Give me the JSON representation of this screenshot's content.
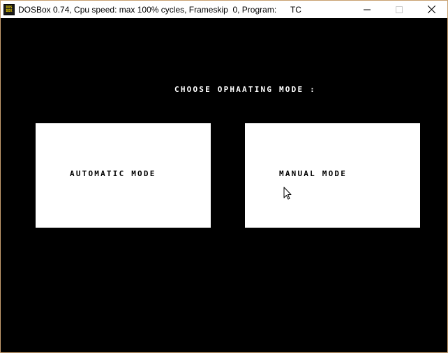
{
  "window": {
    "title": "DOSBox 0.74, Cpu speed: max 100% cycles, Frameskip  0, Program:      TC",
    "icon_text": [
      "DOS",
      "BOX"
    ],
    "controls": [
      "minimize-icon",
      "maximize-icon",
      "close-icon"
    ]
  },
  "screen": {
    "heading": "CHOOSE OPHAATING MODE :",
    "modes": [
      {
        "label": "AUTOMATIC MODE"
      },
      {
        "label": "MANUAL MODE"
      }
    ]
  },
  "colors": {
    "background": "#000000",
    "box": "#ffffff",
    "text_on_black": "#ffffff",
    "text_on_box": "#000000"
  }
}
